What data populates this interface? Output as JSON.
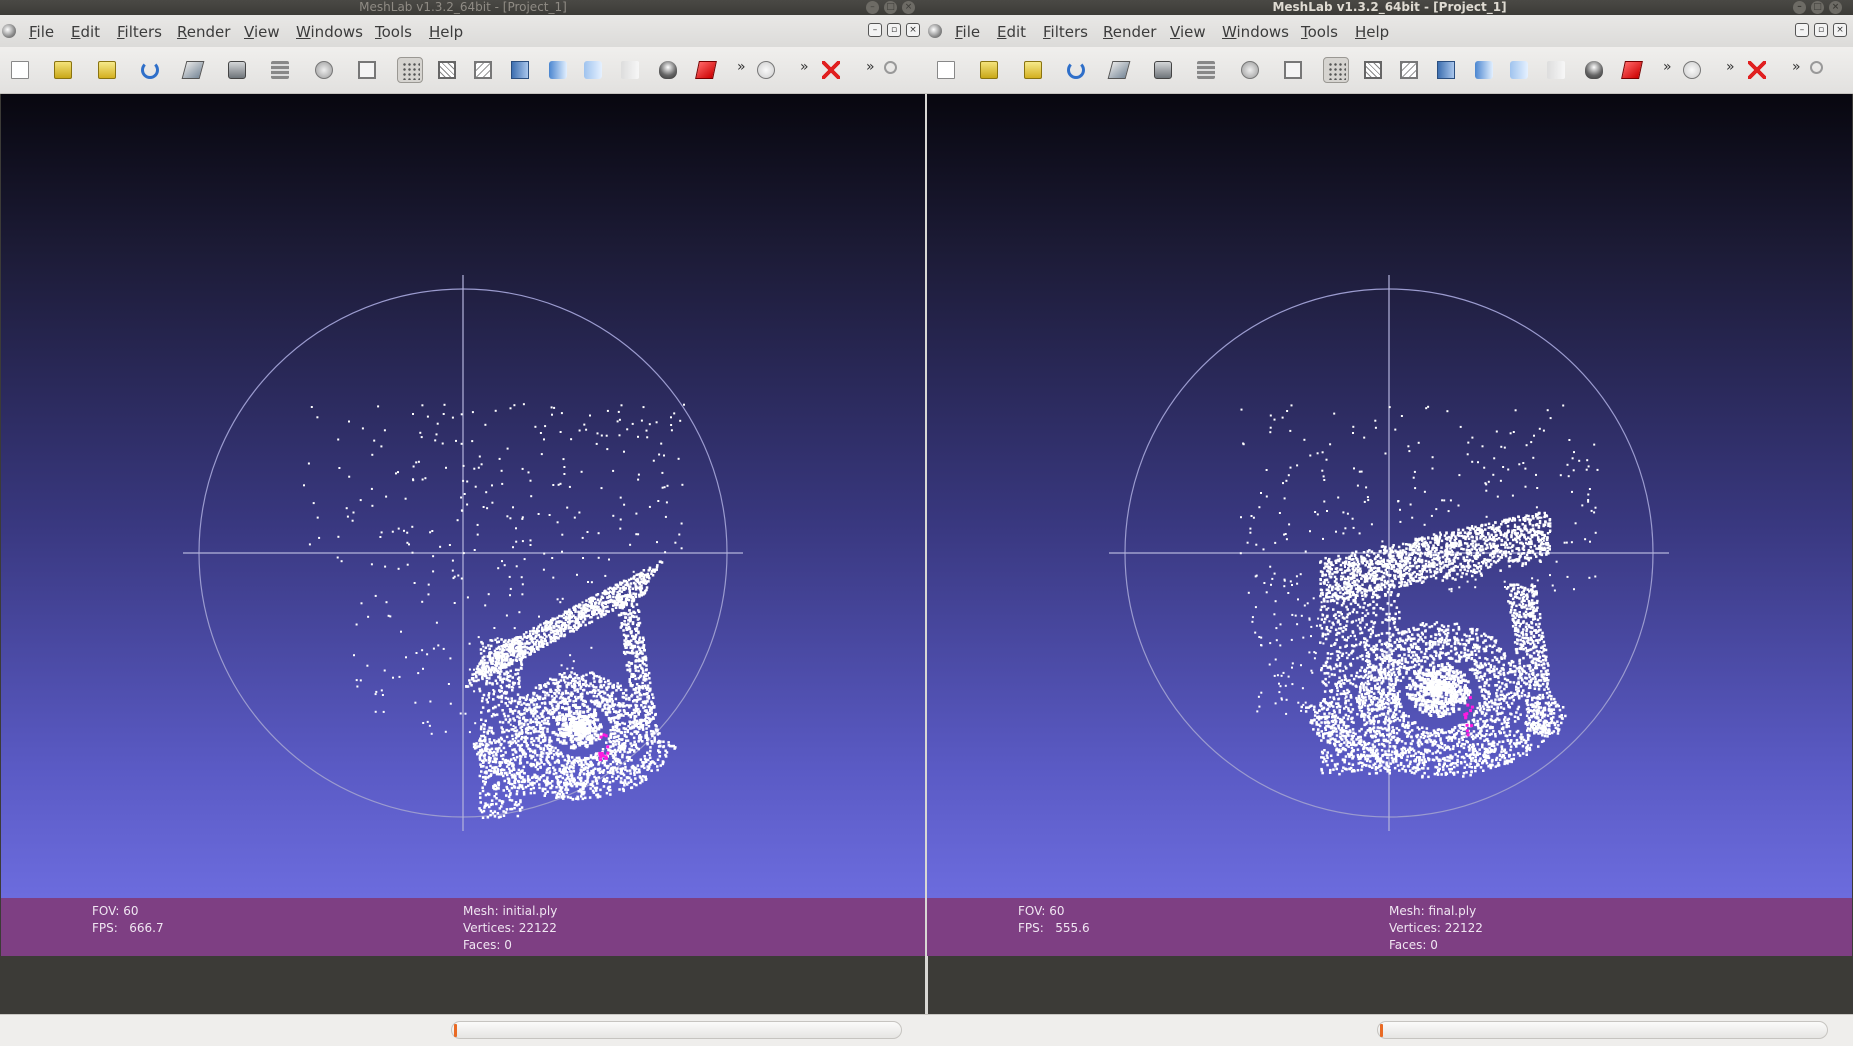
{
  "colors": {
    "titlebar_bg": "#3c3b37",
    "viewport_top": "#08070f",
    "viewport_bottom": "#7474e9",
    "infobar_bg": "#7e3f83",
    "selection_highlight": "#ff1ae0",
    "slider_handle": "#e96a24"
  },
  "menu": [
    "File",
    "Edit",
    "Filters",
    "Render",
    "View",
    "Windows",
    "Tools",
    "Help"
  ],
  "toolbar_icons": [
    "new-document-icon",
    "open-folder-icon",
    "open-project-icon",
    "reload-icon",
    "save-snapshot-icon",
    "camera-icon",
    "layers-icon",
    "globe-bbox-icon",
    "box-icon",
    "points-icon",
    "wireframe-icon",
    "hidden-lines-icon",
    "flat-shading-icon",
    "smooth-shading-icon",
    "vertex-color-icon",
    "texture-icon",
    "light-icon",
    "double-light-icon",
    "overflow-chevron",
    "trackball-icon",
    "overflow-chevron",
    "delete-icon",
    "overflow-chevron",
    "zoom-icon"
  ],
  "windows": [
    {
      "title": "MeshLab v1.3.2_64bit - [Project_1]",
      "fov_line": "FOV: 60",
      "fps_line": "FPS:   666.7",
      "mesh_line": "Mesh: initial.ply",
      "vertices_line": "Vertices: 22122",
      "faces_line": "Faces: 0"
    },
    {
      "title": "MeshLab v1.3.2_64bit - [Project_1]",
      "fov_line": "FOV: 60",
      "fps_line": "FPS:   555.6",
      "mesh_line": "Mesh: final.ply",
      "vertices_line": "Vertices: 22122",
      "faces_line": "Faces: 0"
    }
  ]
}
